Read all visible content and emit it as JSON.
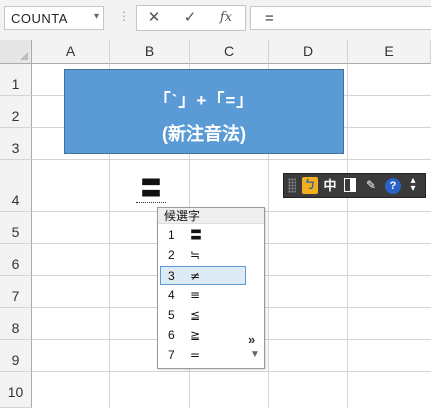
{
  "formula_bar": {
    "name_box": "COUNTA",
    "dropdown_glyph": "▾",
    "divider_glyph": "⋮",
    "cancel_glyph": "✕",
    "enter_glyph": "✓",
    "function_glyph": "fx",
    "formula": "="
  },
  "columns": [
    "A",
    "B",
    "C",
    "D",
    "E"
  ],
  "rows": [
    "1",
    "2",
    "3",
    "4",
    "5",
    "6",
    "7",
    "8",
    "9",
    "10"
  ],
  "banner": {
    "line1": "「`」+「=」",
    "line2": "(新注音法)",
    "fill_color": "#5b9bd5"
  },
  "cell_composition": {
    "text": "〓"
  },
  "ime_toolbar": {
    "logo_glyph": "ㄅ",
    "mode_glyph": "中",
    "pad_glyph": "✎",
    "help_glyph": "?",
    "menu_glyph": "▴\n▾"
  },
  "candidate_window": {
    "title": "候選字",
    "selected_index": 2,
    "items": [
      {
        "num": "1",
        "sym": "〓"
      },
      {
        "num": "2",
        "sym": "≒"
      },
      {
        "num": "3",
        "sym": "≠"
      },
      {
        "num": "4",
        "sym": "≡"
      },
      {
        "num": "5",
        "sym": "≦"
      },
      {
        "num": "6",
        "sym": "≧"
      },
      {
        "num": "7",
        "sym": "="
      }
    ],
    "more_glyph": "»",
    "down_glyph": "▼"
  },
  "colors": {
    "selection_border": "#5b9bd5",
    "selection_fill": "#ddebf7"
  }
}
